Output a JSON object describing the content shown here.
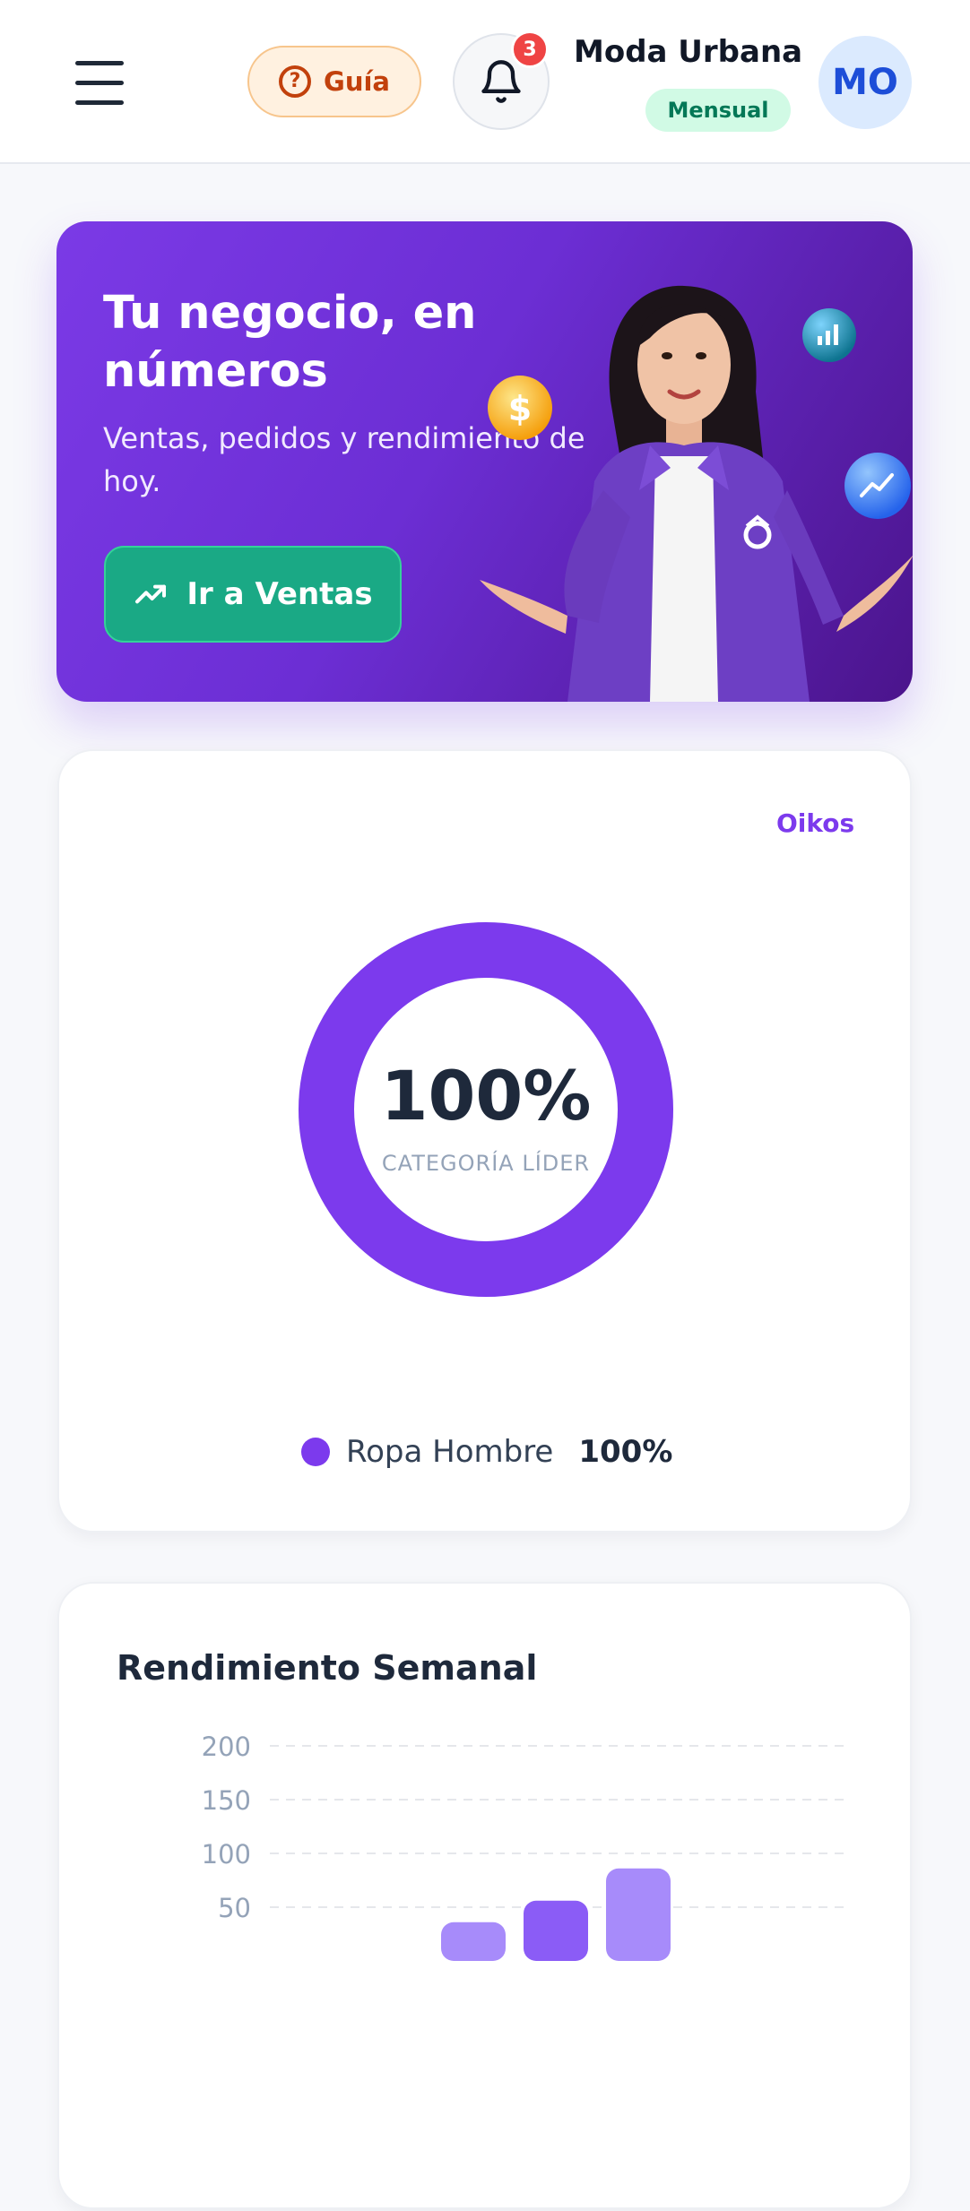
{
  "header": {
    "guide_label": "Guía",
    "notification_count": "3",
    "shop_name": "Moda Urbana",
    "plan": "Mensual",
    "avatar_initials": "MO"
  },
  "hero": {
    "title": "Tu negocio, en números",
    "subtitle": "Ventas, pedidos y rendimiento de hoy.",
    "cta_label": "Ir a Ventas"
  },
  "category_card": {
    "brand": "Oikos",
    "center_value": "100%",
    "center_label": "CATEGORÍA LÍDER",
    "legend": [
      {
        "name": "Ropa Hombre",
        "percent": "100%",
        "color": "#7c3aed"
      }
    ]
  },
  "weekly_card": {
    "title": "Rendimiento Semanal"
  },
  "chart_data": [
    {
      "type": "pie",
      "title": "",
      "labels": [
        "Ropa Hombre"
      ],
      "values": [
        100
      ],
      "colors": [
        "#7c3aed"
      ],
      "center_text": "100%",
      "center_label": "CATEGORÍA LÍDER"
    },
    {
      "type": "bar",
      "title": "Rendimiento Semanal",
      "yticks": [
        200,
        150,
        100,
        50
      ],
      "ylim": [
        0,
        200
      ],
      "values": [
        36,
        56,
        86
      ],
      "colors": [
        "#a78bfa",
        "#8b5cf6",
        "#a78bfa"
      ],
      "grid": true
    }
  ]
}
